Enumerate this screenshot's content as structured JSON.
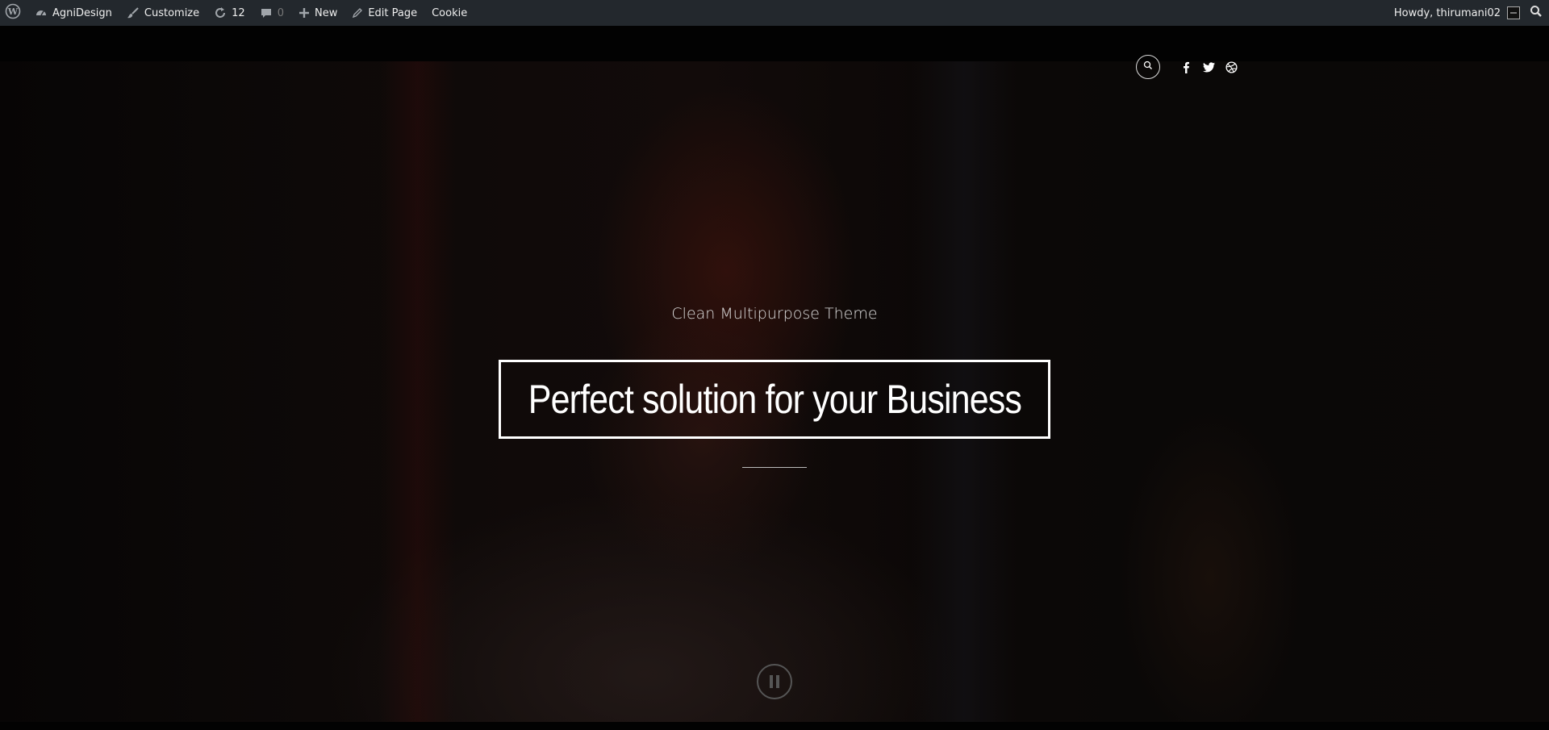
{
  "adminbar": {
    "site_name": "AgniDesign",
    "customize": "Customize",
    "updates_count": "12",
    "comments_count": "0",
    "new_label": "New",
    "edit_page": "Edit Page",
    "cookie": "Cookie",
    "howdy": "Howdy, thirumani02"
  },
  "hero": {
    "tagline": "Clean Multipurpose Theme",
    "headline": "Perfect solution for your Business"
  },
  "icons": {
    "wordpress": "wordpress-logo-icon",
    "dashboard": "dashboard-icon",
    "customize": "brush-icon",
    "updates": "refresh-icon",
    "comments": "comment-icon",
    "new": "plus-icon",
    "edit": "pencil-icon",
    "search": "search-icon",
    "social": [
      "facebook-icon",
      "twitter-icon",
      "dribbble-icon"
    ],
    "pause": "pause-icon"
  },
  "colors": {
    "adminbar_bg": "#23282d",
    "hero_bg": "#000000",
    "text": "#ffffff"
  }
}
